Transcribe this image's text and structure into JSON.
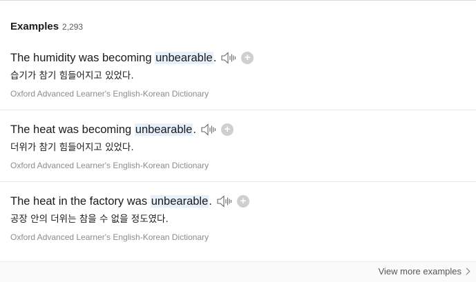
{
  "header": {
    "title": "Examples",
    "count": "2,293"
  },
  "examples": [
    {
      "pre": "The humidity was becoming ",
      "highlight": "unbearable",
      "post": ".",
      "translation": "습기가 참기 힘들어지고 있었다.",
      "source": "Oxford Advanced Learner's English-Korean Dictionary"
    },
    {
      "pre": "The heat was becoming ",
      "highlight": "unbearable",
      "post": ".",
      "translation": "더위가 참기 힘들어지고 있었다.",
      "source": "Oxford Advanced Learner's English-Korean Dictionary"
    },
    {
      "pre": "The heat in the factory was ",
      "highlight": "unbearable",
      "post": ".",
      "translation": "공장 안의 더위는 참을 수 없을 정도였다.",
      "source": "Oxford Advanced Learner's English-Korean Dictionary"
    }
  ],
  "footer": {
    "view_more": "View more examples"
  },
  "icons": {
    "audio": "speaker-icon",
    "add": "plus-circle-icon",
    "more": "chevron-right-icon"
  },
  "colors": {
    "highlight_bg": "#e5f0fb",
    "add_icon_bg": "#cfcfcf",
    "source_text": "#8c8c8c"
  }
}
